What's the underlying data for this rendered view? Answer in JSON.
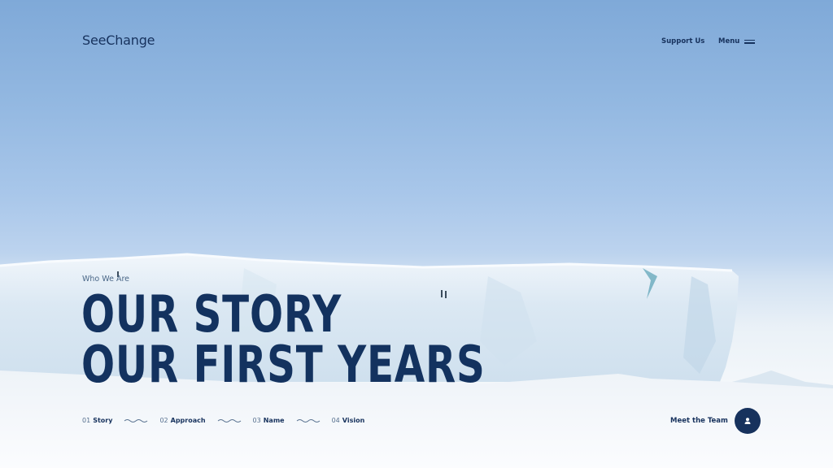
{
  "header": {
    "logo": "SeeChange",
    "support_label": "Support Us",
    "menu_label": "Menu"
  },
  "hero": {
    "eyebrow": "Who We Are",
    "headline_line1": "OUR STORY",
    "headline_line2": "OUR FIRST YEARS"
  },
  "chapters": [
    {
      "num": "01",
      "label": "Story"
    },
    {
      "num": "02",
      "label": "Approach"
    },
    {
      "num": "03",
      "label": "Name"
    },
    {
      "num": "04",
      "label": "Vision"
    }
  ],
  "cta": {
    "label": "Meet the Team",
    "icon": "person-icon"
  },
  "colors": {
    "brand_navy": "#17325d",
    "sky_top": "#7fa9d8",
    "ice": "#e6f0f7"
  },
  "icons": [
    "menu-icon",
    "wave-divider-icon",
    "person-icon"
  ]
}
